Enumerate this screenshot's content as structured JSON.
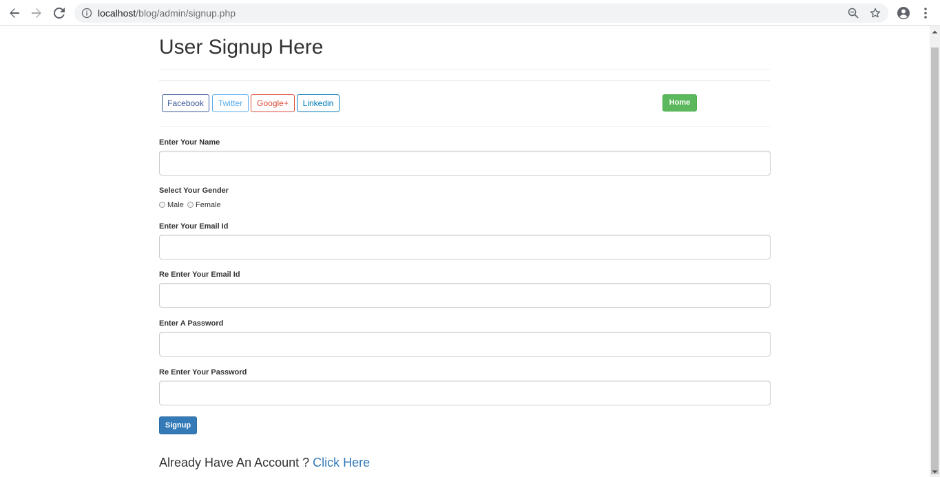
{
  "browser": {
    "url_host": "localhost",
    "url_path": "/blog/admin/signup.php",
    "icons": [
      "back-arrow-icon",
      "forward-arrow-icon",
      "reload-icon",
      "info-icon",
      "zoom-icon",
      "star-icon",
      "account-icon",
      "menu-icon"
    ]
  },
  "page": {
    "title": "User Signup Here",
    "social": {
      "facebook": "Facebook",
      "twitter": "Twitter",
      "google": "Google+",
      "linkedin": "Linkedin"
    },
    "home": "Home",
    "colors": {
      "facebook": "#3b5998",
      "twitter": "#55acee",
      "google": "#dd4b39",
      "linkedin": "#007bb6",
      "home": "#5cb85c",
      "primary": "#337ab7"
    }
  },
  "form": {
    "name_label": "Enter Your Name",
    "name_value": "",
    "gender_label": "Select Your Gender",
    "gender_options": [
      "Male",
      "Female"
    ],
    "email_label": "Enter Your Email Id",
    "email_value": "",
    "reemail_label": "Re Enter Your Email Id",
    "reemail_value": "",
    "password_label": "Enter A Password",
    "password_value": "",
    "repassword_label": "Re Enter Your Password",
    "repassword_value": "",
    "submit": "Signup"
  },
  "footer": {
    "account_text": "Already Have An Account ? ",
    "account_link": "Click Here"
  }
}
